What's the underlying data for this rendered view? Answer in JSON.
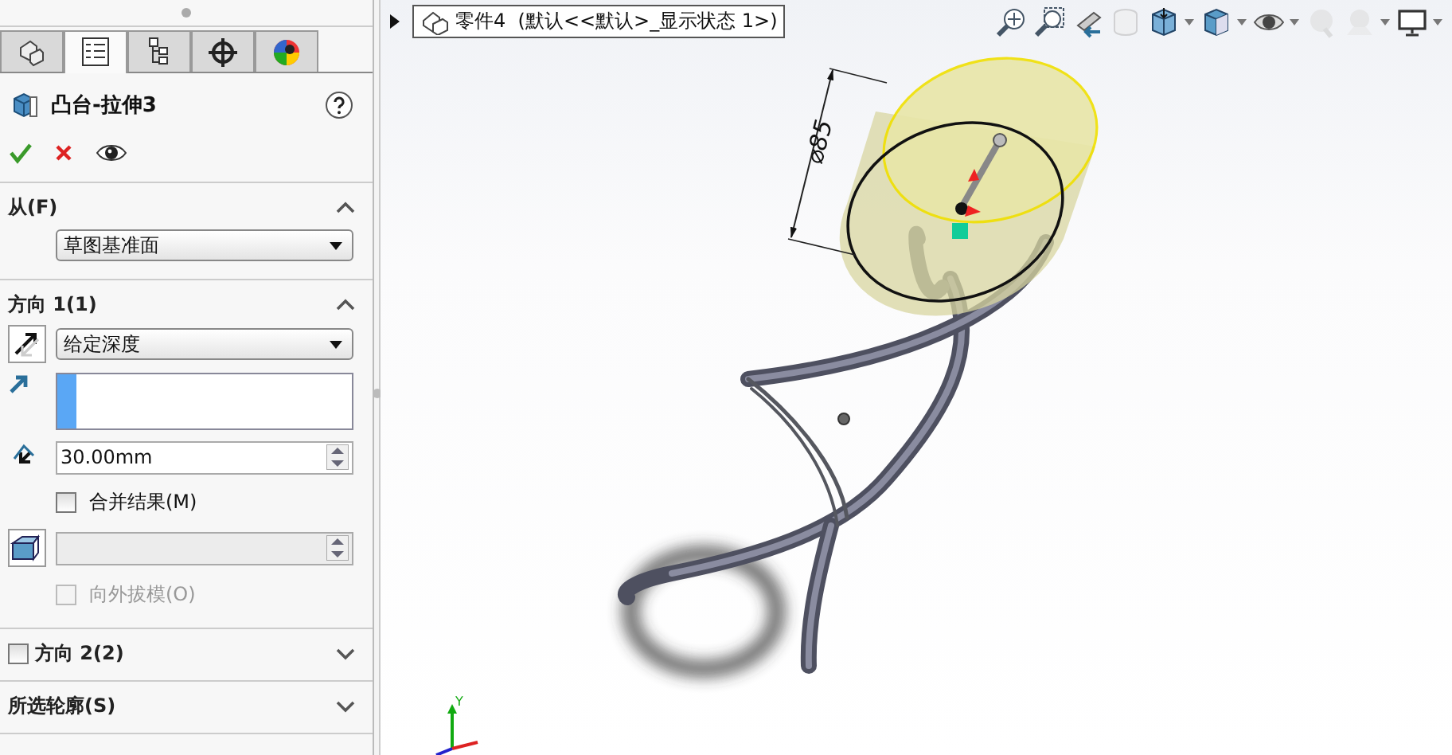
{
  "panel": {
    "tabs": [
      {
        "kind": "feature-tree",
        "selected": false
      },
      {
        "kind": "property",
        "selected": true
      },
      {
        "kind": "config",
        "selected": false
      },
      {
        "kind": "dimxpert",
        "selected": false
      },
      {
        "kind": "display",
        "selected": false
      }
    ],
    "feature": {
      "title": "凸台-拉伸3"
    },
    "sections": [
      {
        "title": "从(F)",
        "expanded": true,
        "items": [
          {
            "kind": "select",
            "value": "草图基准面"
          }
        ]
      },
      {
        "title": "方向 1(1)",
        "expanded": true,
        "items": [
          {
            "kind": "direction-select",
            "value": "给定深度"
          },
          {
            "kind": "list"
          },
          {
            "kind": "depth",
            "value": "30.00mm",
            "disabled": false
          },
          {
            "kind": "check",
            "label": "合并结果(M)",
            "checked": false,
            "disabled": false
          },
          {
            "kind": "draft",
            "disabled": true
          },
          {
            "kind": "check",
            "label": "向外拔模(O)",
            "checked": false,
            "disabled": true
          }
        ]
      },
      {
        "title": "方向 2(2)",
        "expanded": false,
        "checked": false
      },
      {
        "title": "所选轮廓(S)",
        "expanded": false
      }
    ]
  },
  "viewport": {
    "breadcrumb": "零件4  (默认<<默认>_显示状态 1>)",
    "toolbar": [
      {
        "kind": "zoom-fit",
        "disabled": false,
        "caret": false
      },
      {
        "kind": "zoom-area",
        "disabled": false,
        "caret": false
      },
      {
        "kind": "previous-view",
        "disabled": false,
        "caret": false
      },
      {
        "kind": "section",
        "disabled": true,
        "caret": false
      },
      {
        "kind": "orientation",
        "disabled": false,
        "caret": true
      },
      {
        "kind": "display-style",
        "disabled": false,
        "caret": true
      },
      {
        "kind": "hide-show",
        "disabled": false,
        "caret": true
      },
      {
        "kind": "appearance",
        "disabled": true,
        "caret": false
      },
      {
        "kind": "scene",
        "disabled": true,
        "caret": true
      },
      {
        "kind": "monitor",
        "disabled": false,
        "caret": true
      }
    ],
    "dimension": "⌀85",
    "triad_label": "Y"
  }
}
